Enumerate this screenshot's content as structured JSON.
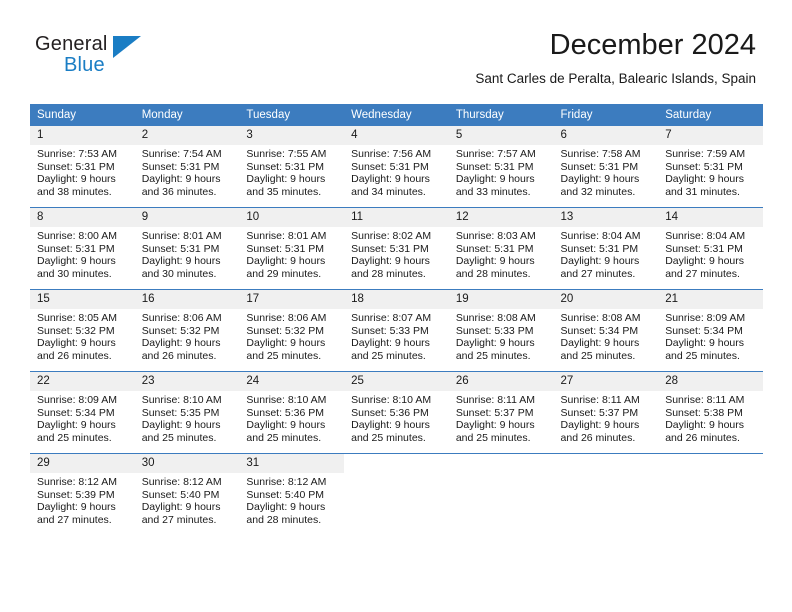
{
  "logo": {
    "word_one": "General",
    "word_two": "Blue",
    "triangle_icon": "triangle-icon",
    "accent_color": "#1a7dc4"
  },
  "header": {
    "title": "December 2024",
    "subtitle": "Sant Carles de Peralta, Balearic Islands, Spain"
  },
  "calendar": {
    "header_color": "#3c7cbf",
    "daynum_bg": "#f0f0f0",
    "weekdays": [
      "Sunday",
      "Monday",
      "Tuesday",
      "Wednesday",
      "Thursday",
      "Friday",
      "Saturday"
    ],
    "weeks": [
      [
        {
          "day": "1",
          "sunrise": "Sunrise: 7:53 AM",
          "sunset": "Sunset: 5:31 PM",
          "daylight_line1": "Daylight: 9 hours",
          "daylight_line2": "and 38 minutes."
        },
        {
          "day": "2",
          "sunrise": "Sunrise: 7:54 AM",
          "sunset": "Sunset: 5:31 PM",
          "daylight_line1": "Daylight: 9 hours",
          "daylight_line2": "and 36 minutes."
        },
        {
          "day": "3",
          "sunrise": "Sunrise: 7:55 AM",
          "sunset": "Sunset: 5:31 PM",
          "daylight_line1": "Daylight: 9 hours",
          "daylight_line2": "and 35 minutes."
        },
        {
          "day": "4",
          "sunrise": "Sunrise: 7:56 AM",
          "sunset": "Sunset: 5:31 PM",
          "daylight_line1": "Daylight: 9 hours",
          "daylight_line2": "and 34 minutes."
        },
        {
          "day": "5",
          "sunrise": "Sunrise: 7:57 AM",
          "sunset": "Sunset: 5:31 PM",
          "daylight_line1": "Daylight: 9 hours",
          "daylight_line2": "and 33 minutes."
        },
        {
          "day": "6",
          "sunrise": "Sunrise: 7:58 AM",
          "sunset": "Sunset: 5:31 PM",
          "daylight_line1": "Daylight: 9 hours",
          "daylight_line2": "and 32 minutes."
        },
        {
          "day": "7",
          "sunrise": "Sunrise: 7:59 AM",
          "sunset": "Sunset: 5:31 PM",
          "daylight_line1": "Daylight: 9 hours",
          "daylight_line2": "and 31 minutes."
        }
      ],
      [
        {
          "day": "8",
          "sunrise": "Sunrise: 8:00 AM",
          "sunset": "Sunset: 5:31 PM",
          "daylight_line1": "Daylight: 9 hours",
          "daylight_line2": "and 30 minutes."
        },
        {
          "day": "9",
          "sunrise": "Sunrise: 8:01 AM",
          "sunset": "Sunset: 5:31 PM",
          "daylight_line1": "Daylight: 9 hours",
          "daylight_line2": "and 30 minutes."
        },
        {
          "day": "10",
          "sunrise": "Sunrise: 8:01 AM",
          "sunset": "Sunset: 5:31 PM",
          "daylight_line1": "Daylight: 9 hours",
          "daylight_line2": "and 29 minutes."
        },
        {
          "day": "11",
          "sunrise": "Sunrise: 8:02 AM",
          "sunset": "Sunset: 5:31 PM",
          "daylight_line1": "Daylight: 9 hours",
          "daylight_line2": "and 28 minutes."
        },
        {
          "day": "12",
          "sunrise": "Sunrise: 8:03 AM",
          "sunset": "Sunset: 5:31 PM",
          "daylight_line1": "Daylight: 9 hours",
          "daylight_line2": "and 28 minutes."
        },
        {
          "day": "13",
          "sunrise": "Sunrise: 8:04 AM",
          "sunset": "Sunset: 5:31 PM",
          "daylight_line1": "Daylight: 9 hours",
          "daylight_line2": "and 27 minutes."
        },
        {
          "day": "14",
          "sunrise": "Sunrise: 8:04 AM",
          "sunset": "Sunset: 5:31 PM",
          "daylight_line1": "Daylight: 9 hours",
          "daylight_line2": "and 27 minutes."
        }
      ],
      [
        {
          "day": "15",
          "sunrise": "Sunrise: 8:05 AM",
          "sunset": "Sunset: 5:32 PM",
          "daylight_line1": "Daylight: 9 hours",
          "daylight_line2": "and 26 minutes."
        },
        {
          "day": "16",
          "sunrise": "Sunrise: 8:06 AM",
          "sunset": "Sunset: 5:32 PM",
          "daylight_line1": "Daylight: 9 hours",
          "daylight_line2": "and 26 minutes."
        },
        {
          "day": "17",
          "sunrise": "Sunrise: 8:06 AM",
          "sunset": "Sunset: 5:32 PM",
          "daylight_line1": "Daylight: 9 hours",
          "daylight_line2": "and 25 minutes."
        },
        {
          "day": "18",
          "sunrise": "Sunrise: 8:07 AM",
          "sunset": "Sunset: 5:33 PM",
          "daylight_line1": "Daylight: 9 hours",
          "daylight_line2": "and 25 minutes."
        },
        {
          "day": "19",
          "sunrise": "Sunrise: 8:08 AM",
          "sunset": "Sunset: 5:33 PM",
          "daylight_line1": "Daylight: 9 hours",
          "daylight_line2": "and 25 minutes."
        },
        {
          "day": "20",
          "sunrise": "Sunrise: 8:08 AM",
          "sunset": "Sunset: 5:34 PM",
          "daylight_line1": "Daylight: 9 hours",
          "daylight_line2": "and 25 minutes."
        },
        {
          "day": "21",
          "sunrise": "Sunrise: 8:09 AM",
          "sunset": "Sunset: 5:34 PM",
          "daylight_line1": "Daylight: 9 hours",
          "daylight_line2": "and 25 minutes."
        }
      ],
      [
        {
          "day": "22",
          "sunrise": "Sunrise: 8:09 AM",
          "sunset": "Sunset: 5:34 PM",
          "daylight_line1": "Daylight: 9 hours",
          "daylight_line2": "and 25 minutes."
        },
        {
          "day": "23",
          "sunrise": "Sunrise: 8:10 AM",
          "sunset": "Sunset: 5:35 PM",
          "daylight_line1": "Daylight: 9 hours",
          "daylight_line2": "and 25 minutes."
        },
        {
          "day": "24",
          "sunrise": "Sunrise: 8:10 AM",
          "sunset": "Sunset: 5:36 PM",
          "daylight_line1": "Daylight: 9 hours",
          "daylight_line2": "and 25 minutes."
        },
        {
          "day": "25",
          "sunrise": "Sunrise: 8:10 AM",
          "sunset": "Sunset: 5:36 PM",
          "daylight_line1": "Daylight: 9 hours",
          "daylight_line2": "and 25 minutes."
        },
        {
          "day": "26",
          "sunrise": "Sunrise: 8:11 AM",
          "sunset": "Sunset: 5:37 PM",
          "daylight_line1": "Daylight: 9 hours",
          "daylight_line2": "and 25 minutes."
        },
        {
          "day": "27",
          "sunrise": "Sunrise: 8:11 AM",
          "sunset": "Sunset: 5:37 PM",
          "daylight_line1": "Daylight: 9 hours",
          "daylight_line2": "and 26 minutes."
        },
        {
          "day": "28",
          "sunrise": "Sunrise: 8:11 AM",
          "sunset": "Sunset: 5:38 PM",
          "daylight_line1": "Daylight: 9 hours",
          "daylight_line2": "and 26 minutes."
        }
      ],
      [
        {
          "day": "29",
          "sunrise": "Sunrise: 8:12 AM",
          "sunset": "Sunset: 5:39 PM",
          "daylight_line1": "Daylight: 9 hours",
          "daylight_line2": "and 27 minutes."
        },
        {
          "day": "30",
          "sunrise": "Sunrise: 8:12 AM",
          "sunset": "Sunset: 5:40 PM",
          "daylight_line1": "Daylight: 9 hours",
          "daylight_line2": "and 27 minutes."
        },
        {
          "day": "31",
          "sunrise": "Sunrise: 8:12 AM",
          "sunset": "Sunset: 5:40 PM",
          "daylight_line1": "Daylight: 9 hours",
          "daylight_line2": "and 28 minutes."
        },
        {
          "day": "",
          "sunrise": "",
          "sunset": "",
          "daylight_line1": "",
          "daylight_line2": ""
        },
        {
          "day": "",
          "sunrise": "",
          "sunset": "",
          "daylight_line1": "",
          "daylight_line2": ""
        },
        {
          "day": "",
          "sunrise": "",
          "sunset": "",
          "daylight_line1": "",
          "daylight_line2": ""
        },
        {
          "day": "",
          "sunrise": "",
          "sunset": "",
          "daylight_line1": "",
          "daylight_line2": ""
        }
      ]
    ]
  }
}
